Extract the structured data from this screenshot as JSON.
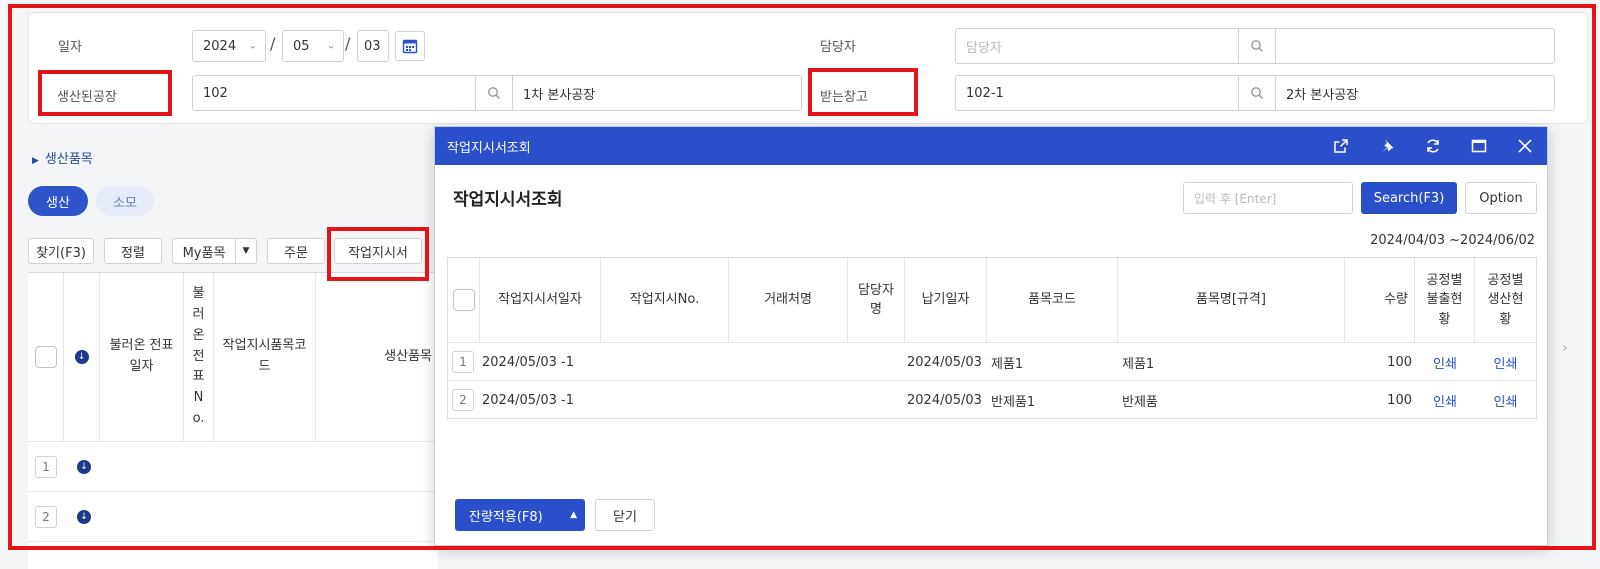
{
  "form": {
    "date_label": "일자",
    "year": "2024",
    "month": "05",
    "day": "03",
    "date_sep": "/",
    "factory_label": "생산된공장",
    "factory_code": "102",
    "factory_name": "1차 본사공장",
    "manager_label": "담당자",
    "manager_placeholder": "담당자",
    "warehouse_label": "받는창고",
    "warehouse_code": "102-1",
    "warehouse_name": "2차 본사공장"
  },
  "section": {
    "title": "생산품목"
  },
  "toggle": {
    "produce": "생산",
    "consume": "소모"
  },
  "toolbar": {
    "find": "찾기(F3)",
    "sort": "정렬",
    "my_items": "My품목",
    "order": "주문",
    "work_order": "작업지시서"
  },
  "grid": {
    "headers": {
      "loaded_date": "불러온 전표일자",
      "loaded_no": "불러온전표No.",
      "item_code": "작업지시품목코드",
      "product": "생산품목"
    },
    "rows": [
      {
        "num": "1"
      },
      {
        "num": "2"
      }
    ]
  },
  "modal": {
    "window_title": "작업지시서조회",
    "title": "작업지시서조회",
    "search_placeholder": "입력 후 [Enter]",
    "search_button": "Search(F3)",
    "option_button": "Option",
    "date_range": "2024/04/03 ~2024/06/02",
    "headers": {
      "date": "작업지시서일자",
      "no": "작업지시No.",
      "client": "거래처명",
      "manager": "담당자명",
      "due": "납기일자",
      "item_code": "품목코드",
      "item_name": "품목명[규격]",
      "qty": "수량",
      "issue_status": "공정별불출현황",
      "prod_status": "공정별생산현황"
    },
    "rows": [
      {
        "num": "1",
        "date": "2024/05/03 -1",
        "due": "2024/05/03",
        "item_code": "제품1",
        "item_name": "제품1",
        "qty": "100",
        "issue": "인쇄",
        "prod": "인쇄"
      },
      {
        "num": "2",
        "date": "2024/05/03 -1",
        "due": "2024/05/03",
        "item_code": "반제품1",
        "item_name": "반제품",
        "qty": "100",
        "issue": "인쇄",
        "prod": "인쇄"
      }
    ],
    "apply_button": "잔량적용(F8)",
    "close_button": "닫기"
  },
  "colors": {
    "accent": "#2a4fcb",
    "highlight": "#e3141a"
  }
}
